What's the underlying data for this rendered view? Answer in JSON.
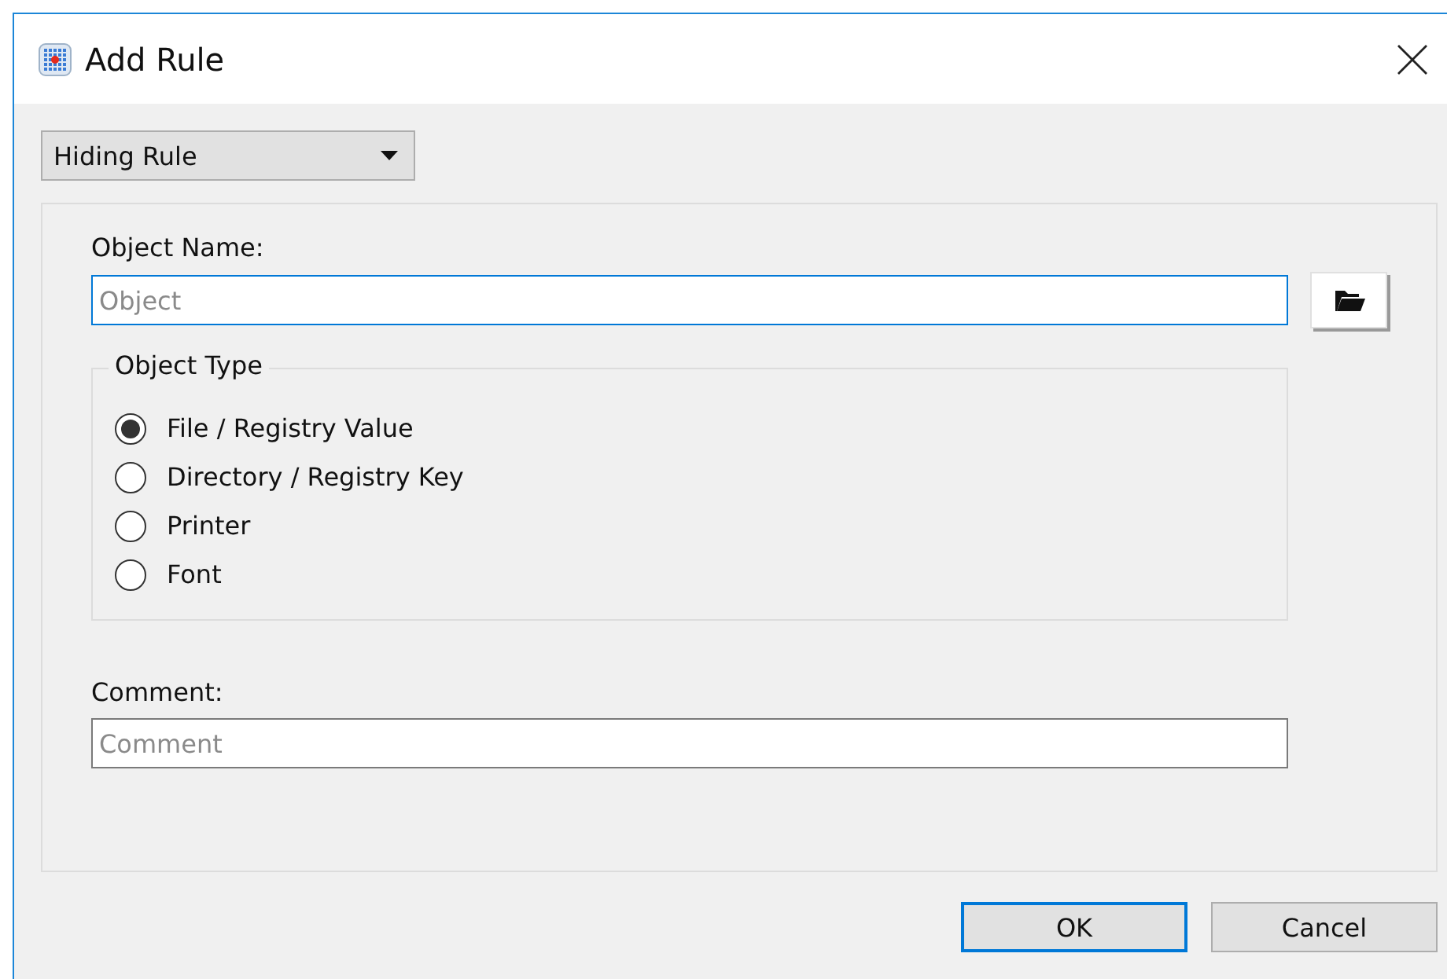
{
  "window": {
    "title": "Add Rule"
  },
  "rule_type": {
    "value": "Hiding Rule"
  },
  "object_name": {
    "label": "Object Name:",
    "placeholder": "Object",
    "focused": true
  },
  "object_type": {
    "label": "Object Type",
    "options": [
      {
        "label": "File / Registry Value",
        "selected": true
      },
      {
        "label": "Directory / Registry Key",
        "selected": false
      },
      {
        "label": "Printer",
        "selected": false
      },
      {
        "label": "Font",
        "selected": false
      }
    ]
  },
  "comment": {
    "label": "Comment:",
    "placeholder": "Comment"
  },
  "buttons": [
    {
      "label": "OK",
      "default": true
    },
    {
      "label": "Cancel",
      "default": false
    }
  ]
}
